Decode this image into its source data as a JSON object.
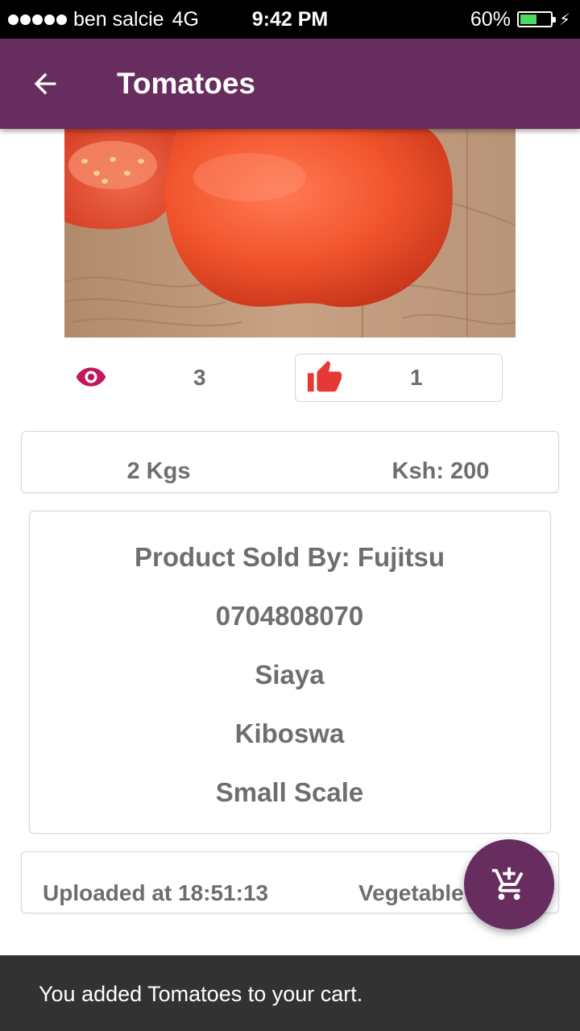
{
  "status_bar": {
    "carrier": "ben salcie",
    "network": "4G",
    "time": "9:42 PM",
    "battery_percent": "60%",
    "battery_level": 0.6,
    "battery_color": "#4cd964"
  },
  "app_bar": {
    "title": "Tomatoes",
    "back_icon": "arrow-left-icon",
    "color": "#662d5e"
  },
  "product": {
    "image_subject": "tomato-photo",
    "views": "3",
    "likes": "1",
    "view_icon": "eye-icon",
    "like_icon": "thumbs-up-icon",
    "quantity": "2 Kgs",
    "price": "Ksh: 200"
  },
  "seller": {
    "sold_by": "Product Sold  By: Fujitsu",
    "phone": "0704808070",
    "county": "Siaya",
    "location": "Kiboswa",
    "scale": "Small Scale"
  },
  "upload": {
    "uploaded_at": "Uploaded at 18:51:13",
    "category": "Vegetable"
  },
  "fab": {
    "icon": "add-to-cart-icon"
  },
  "snackbar": {
    "message": "You added Tomatoes to your cart."
  }
}
